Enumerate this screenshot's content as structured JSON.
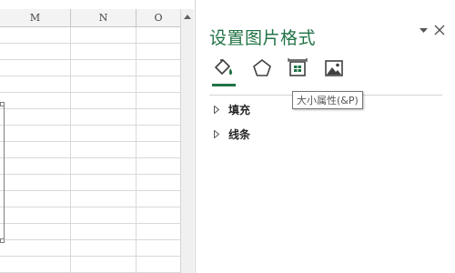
{
  "sheet": {
    "columns": [
      "M",
      "N",
      "O"
    ]
  },
  "pane": {
    "title": "设置图片格式",
    "menu_icon": "dropdown-caret-icon",
    "close_icon": "close-icon",
    "tabs": [
      {
        "icon": "fill-line-icon",
        "active": true
      },
      {
        "icon": "effects-pentagon-icon",
        "active": false
      },
      {
        "icon": "size-properties-icon",
        "active": false
      },
      {
        "icon": "picture-icon",
        "active": false
      }
    ],
    "tooltip": "大小属性(&P)",
    "sections": [
      {
        "label": "填充"
      },
      {
        "label": "线条"
      }
    ]
  },
  "colors": {
    "accent": "#217346",
    "header_bg": "#f3f3f3",
    "gridline": "#d9d9d9"
  }
}
